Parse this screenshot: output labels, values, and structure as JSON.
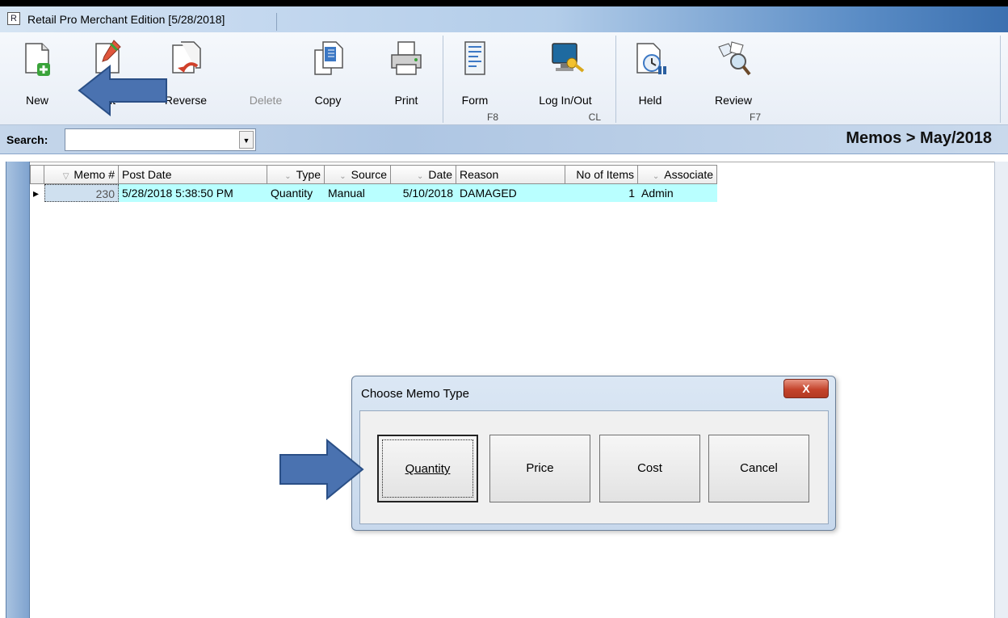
{
  "window": {
    "title": "Retail Pro Merchant Edition [5/28/2018]"
  },
  "toolbar": {
    "new": "New",
    "edit": "Edit",
    "reverse": "Reverse",
    "delete": "Delete",
    "copy": "Copy",
    "print": "Print",
    "form": "Form",
    "form_key": "F8",
    "login": "Log In/Out",
    "login_key": "CL",
    "held": "Held",
    "review": "Review",
    "review_key": "F7"
  },
  "search": {
    "label": "Search:",
    "value": ""
  },
  "breadcrumb": "Memos > May/2018",
  "grid": {
    "columns": [
      "Memo #",
      "Post Date",
      "Type",
      "Source",
      "Date",
      "Reason",
      "No of Items",
      "Associate"
    ],
    "rows": [
      {
        "memo": "230",
        "post_date": "5/28/2018 5:38:50 PM",
        "type": "Quantity",
        "source": "Manual",
        "date": "5/10/2018",
        "reason": "DAMAGED",
        "items": "1",
        "associate": "Admin"
      }
    ]
  },
  "dialog": {
    "title": "Choose Memo Type",
    "close": "X",
    "buttons": {
      "quantity": "Quantity",
      "price": "Price",
      "cost": "Cost",
      "cancel": "Cancel"
    }
  },
  "colors": {
    "arrow": "#4a72b0",
    "row_highlight": "#b9ffff",
    "close_button": "#c4442c"
  },
  "icons": [
    "new-icon",
    "edit-icon",
    "reverse-icon",
    "copy-icon",
    "print-icon",
    "form-icon",
    "login-icon",
    "held-icon",
    "review-icon",
    "dropdown-arrow-icon",
    "close-icon",
    "arrow-annotation"
  ]
}
